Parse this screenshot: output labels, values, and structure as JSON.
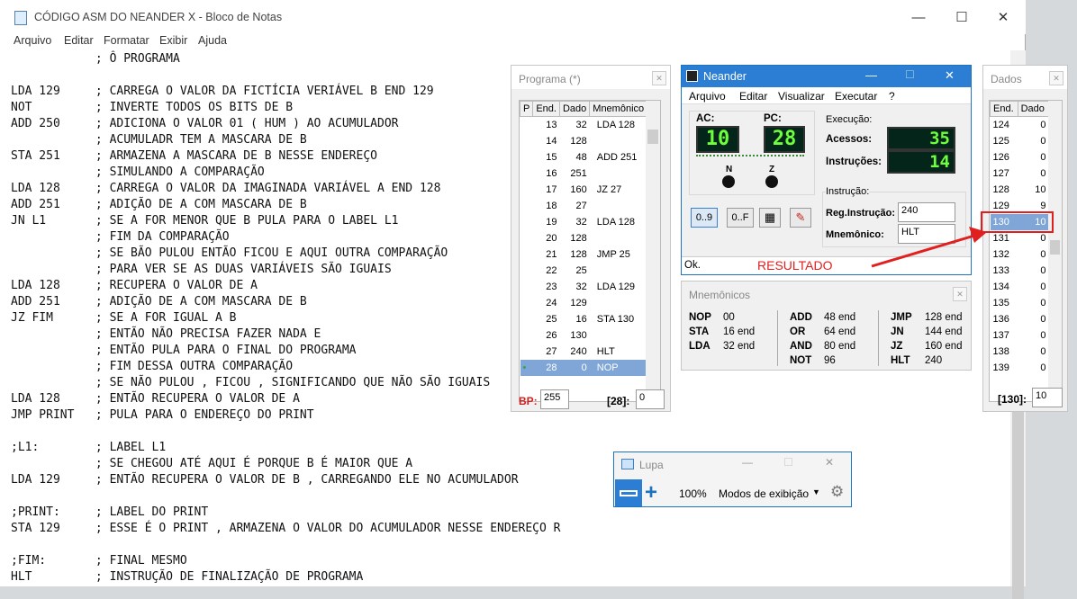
{
  "notepad": {
    "title": "CÓDIGO ASM DO  NEANDER X - Bloco de Notas",
    "menu": [
      "Arquivo",
      "Editar",
      "Formatar",
      "Exibir",
      "Ajuda"
    ],
    "lines": [
      "            ; Ô PROGRAMA",
      "",
      "LDA 129     ; CARREGA O VALOR DA FICTÍCIA VERIÁVEL B END 129",
      "NOT         ; INVERTE TODOS OS BITS DE B",
      "ADD 250     ; ADICIONA O VALOR 01 ( HUM ) AO ACUMULADOR",
      "            ; ACUMULADR TEM A MASCARA DE B",
      "STA 251     ; ARMAZENA A MASCARA DE B NESSE ENDEREÇO",
      "            ; SIMULANDO A COMPARAÇÃO",
      "LDA 128     ; CARREGA O VALOR DA IMAGINADA VARIÁVEL A END 128",
      "ADD 251     ; ADIÇÃO DE A COM MASCARA DE B",
      "JN L1       ; SE A FOR MENOR QUE B PULA PARA O LABEL L1",
      "            ; FIM DA COMPARAÇÃO",
      "            ; SE BÃO PULOU ENTÃO FICOU E AQUI OUTRA COMPARAÇÃO",
      "            ; PARA VER SE AS DUAS VARIÁVEIS SÃO IGUAIS",
      "LDA 128     ; RECUPERA O VALOR DE A",
      "ADD 251     ; ADIÇÃO DE A COM MASCARA DE B",
      "JZ FIM      ; SE A FOR IGUAL A B",
      "            ; ENTÃO NÃO PRECISA FAZER NADA E",
      "            ; ENTÃO PULA PARA O FINAL DO PROGRAMA",
      "            ; FIM DESSA OUTRA COMPARAÇÃO",
      "            ; SE NÃO PULOU , FICOU , SIGNIFICANDO QUE NÃO SÃO IGUAIS",
      "LDA 128     ; ENTÃO RECUPERA O VALOR DE A",
      "JMP PRINT   ; PULA PARA O ENDEREÇO DO PRINT",
      "",
      ";L1:        ; LABEL L1",
      "            ; SE CHEGOU ATÉ AQUI É PORQUE B É MAIOR QUE A",
      "LDA 129     ; ENTÃO RECUPERA O VALOR DE B , CARREGANDO ELE NO ACUMULADOR",
      "",
      ";PRINT:     ; LABEL DO PRINT",
      "STA 129     ; ESSE É O PRINT , ARMAZENA O VALOR DO ACUMULADOR NESSE ENDEREÇO R",
      "",
      ";FIM:       ; FINAL MESMO",
      "HLT         ; INSTRUÇÃO DE FINALIZAÇÃO DE PROGRAMA"
    ]
  },
  "programa": {
    "title": "Programa  (*)",
    "headers": [
      "P",
      "End.",
      "Dado",
      "Mnemônico"
    ],
    "rows": [
      [
        "",
        "13",
        "32",
        "LDA  128"
      ],
      [
        "",
        "14",
        "128",
        ""
      ],
      [
        "",
        "15",
        "48",
        "ADD  251"
      ],
      [
        "",
        "16",
        "251",
        ""
      ],
      [
        "",
        "17",
        "160",
        "JZ   27"
      ],
      [
        "",
        "18",
        "27",
        ""
      ],
      [
        "",
        "19",
        "32",
        "LDA  128"
      ],
      [
        "",
        "20",
        "128",
        ""
      ],
      [
        "",
        "21",
        "128",
        "JMP  25"
      ],
      [
        "",
        "22",
        "25",
        ""
      ],
      [
        "",
        "23",
        "32",
        "LDA  129"
      ],
      [
        "",
        "24",
        "129",
        ""
      ],
      [
        "",
        "25",
        "16",
        "STA  130"
      ],
      [
        "",
        "26",
        "130",
        ""
      ],
      [
        "",
        "27",
        "240",
        "HLT"
      ],
      [
        "•",
        "28",
        "0",
        "NOP"
      ]
    ],
    "bp_label": "BP:",
    "bp_value": "255",
    "addr_label": "[28]:",
    "addr_value": "0"
  },
  "neander": {
    "title": "Neander",
    "menu": [
      "Arquivo",
      "Editar",
      "Visualizar",
      "Executar",
      "?"
    ],
    "ac_label": "AC:",
    "ac_value": "10",
    "pc_label": "PC:",
    "pc_value": "28",
    "n_label": "N",
    "z_label": "Z",
    "execucao_label": "Execução:",
    "acessos_label": "Acessos:",
    "acessos_value": "35",
    "instrucoes_label": "Instruções:",
    "instrucoes_value": "14",
    "instrucao_label": "Instrução:",
    "reg_label": "Reg.Instrução:",
    "reg_value": "240",
    "mnem_label": "Mnemônico:",
    "mnem_value": "HLT",
    "btn_dec": "0..9",
    "btn_hex": "0..F",
    "status": "Ok.",
    "resultado": "RESULTADO"
  },
  "mnemonicos": {
    "title": "Mnemônicos",
    "col1": [
      [
        "NOP",
        "00"
      ],
      [
        "STA",
        "16 end"
      ],
      [
        "LDA",
        "32 end"
      ]
    ],
    "col2": [
      [
        "ADD",
        "48 end"
      ],
      [
        "OR",
        "64 end"
      ],
      [
        "AND",
        "80 end"
      ],
      [
        "NOT",
        "96"
      ]
    ],
    "col3": [
      [
        "JMP",
        "128 end"
      ],
      [
        "JN",
        "144 end"
      ],
      [
        "JZ",
        "160 end"
      ],
      [
        "HLT",
        "240"
      ]
    ]
  },
  "dados": {
    "title": "Dados",
    "headers": [
      "End.",
      "Dado"
    ],
    "rows": [
      [
        "124",
        "0"
      ],
      [
        "125",
        "0"
      ],
      [
        "126",
        "0"
      ],
      [
        "127",
        "0"
      ],
      [
        "128",
        "10"
      ],
      [
        "129",
        "9"
      ],
      [
        "130",
        "10"
      ],
      [
        "131",
        "0"
      ],
      [
        "132",
        "0"
      ],
      [
        "133",
        "0"
      ],
      [
        "134",
        "0"
      ],
      [
        "135",
        "0"
      ],
      [
        "136",
        "0"
      ],
      [
        "137",
        "0"
      ],
      [
        "138",
        "0"
      ],
      [
        "139",
        "0"
      ]
    ],
    "addr_label": "[130]:",
    "addr_value": "10"
  },
  "lupa": {
    "title": "Lupa",
    "zoom": "100%",
    "modes": "Modos de exibição"
  },
  "colors": {
    "accent": "#2b7ed3",
    "lcd": "#6eff3c",
    "highlight": "#e11f1f"
  }
}
